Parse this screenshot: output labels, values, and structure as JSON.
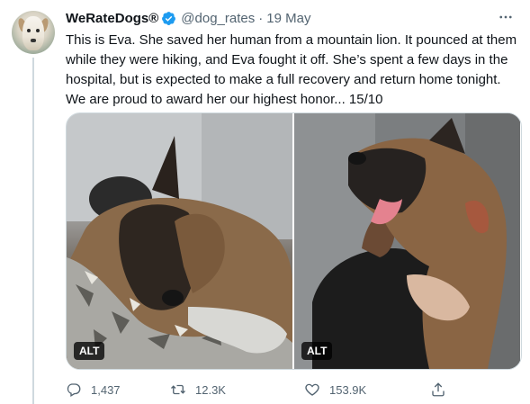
{
  "author": {
    "name": "WeRateDogs®",
    "handle": "@dog_rates",
    "separator": "·",
    "time": "19 May",
    "verified_color": "#1d9bf0"
  },
  "more_label": "•••",
  "tweet_text": "This is Eva. She saved her human from a mountain lion. It pounced at them while they were hiking, and Eva fought it off. She’s spent a few days in the hospital, but is expected to make a full recovery and return home tonight. We are proud to award her our highest honor... 15/10",
  "media": [
    {
      "alt_badge": "ALT"
    },
    {
      "alt_badge": "ALT"
    }
  ],
  "actions": {
    "reply": {
      "count": "1,437",
      "icon": "reply-icon"
    },
    "retweet": {
      "count": "12.3K",
      "icon": "retweet-icon"
    },
    "like": {
      "count": "153.9K",
      "icon": "heart-icon"
    },
    "share": {
      "icon": "share-icon"
    }
  },
  "colors": {
    "text": "#0f1419",
    "secondary": "#536471",
    "border": "#cfd9de"
  }
}
